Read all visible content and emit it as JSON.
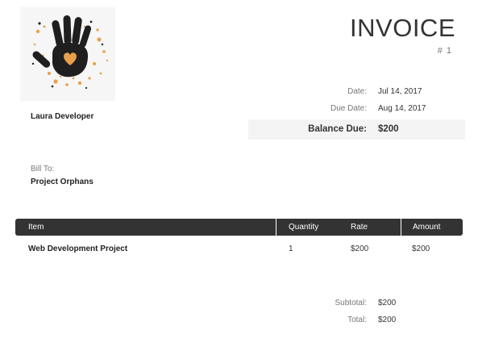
{
  "invoice": {
    "title": "INVOICE",
    "number": "# 1"
  },
  "from": {
    "name": "Laura Developer"
  },
  "meta": {
    "date_label": "Date:",
    "date_value": "Jul 14, 2017",
    "due_label": "Due Date:",
    "due_value": "Aug 14, 2017",
    "balance_label": "Balance Due:",
    "balance_value": "$200"
  },
  "bill_to": {
    "label": "Bill To:",
    "name": "Project Orphans"
  },
  "table": {
    "headers": [
      "Item",
      "Quantity",
      "Rate",
      "Amount"
    ],
    "rows": [
      {
        "item": "Web Development Project",
        "quantity": "1",
        "rate": "$200",
        "amount": "$200"
      }
    ]
  },
  "totals": {
    "subtotal_label": "Subtotal:",
    "subtotal_value": "$200",
    "total_label": "Total:",
    "total_value": "$200"
  },
  "colors": {
    "header_bg": "#333333",
    "balance_bg": "#f4f4f4",
    "logo_orange": "#e8a04a"
  },
  "icons": {
    "logo": "handprint-logo-icon"
  }
}
